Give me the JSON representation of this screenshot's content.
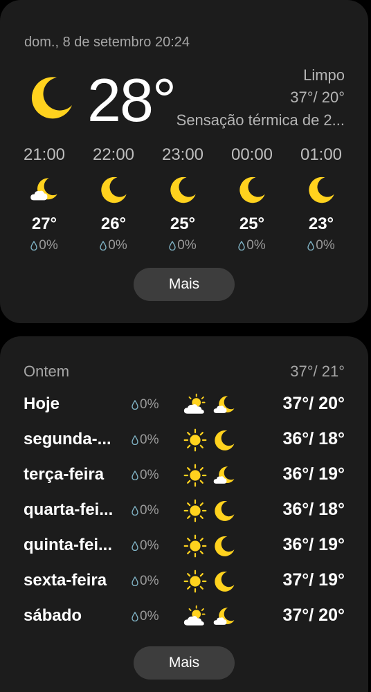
{
  "colors": {
    "card": "#1c1c1c",
    "button": "#3d3d3d",
    "icon_yellow": "#ffd21e",
    "muted_text": "#a6a6a6"
  },
  "current": {
    "date": "dom., 8 de setembro 20:24",
    "temp": "28°",
    "icon": "moon-icon",
    "condition": "Limpo",
    "range": "37°/ 20°",
    "feels_like": "Sensação térmica de 2..."
  },
  "hourly": [
    {
      "time": "21:00",
      "icon": "partly-cloudy-night-icon",
      "temp": "27°",
      "rain": "0%"
    },
    {
      "time": "22:00",
      "icon": "moon-icon",
      "temp": "26°",
      "rain": "0%"
    },
    {
      "time": "23:00",
      "icon": "moon-icon",
      "temp": "25°",
      "rain": "0%"
    },
    {
      "time": "00:00",
      "icon": "moon-icon",
      "temp": "25°",
      "rain": "0%"
    },
    {
      "time": "01:00",
      "icon": "moon-icon",
      "temp": "23°",
      "rain": "0%"
    }
  ],
  "more_label": "Mais",
  "yesterday": {
    "label": "Ontem",
    "range": "37°/ 21°"
  },
  "daily": [
    {
      "day": "Hoje",
      "rain": "0%",
      "day_icon": "partly-cloudy-day-icon",
      "night_icon": "partly-cloudy-night-icon",
      "range": "37°/ 20°"
    },
    {
      "day": "segunda-...",
      "rain": "0%",
      "day_icon": "sun-icon",
      "night_icon": "moon-icon",
      "range": "36°/ 18°"
    },
    {
      "day": "terça-feira",
      "rain": "0%",
      "day_icon": "sun-icon",
      "night_icon": "partly-cloudy-night-icon",
      "range": "36°/ 19°"
    },
    {
      "day": "quarta-fei...",
      "rain": "0%",
      "day_icon": "sun-icon",
      "night_icon": "moon-icon",
      "range": "36°/ 18°"
    },
    {
      "day": "quinta-fei...",
      "rain": "0%",
      "day_icon": "sun-icon",
      "night_icon": "moon-icon",
      "range": "36°/ 19°"
    },
    {
      "day": "sexta-feira",
      "rain": "0%",
      "day_icon": "sun-icon",
      "night_icon": "moon-icon",
      "range": "37°/ 19°"
    },
    {
      "day": "sábado",
      "rain": "0%",
      "day_icon": "partly-cloudy-day-icon",
      "night_icon": "partly-cloudy-night-icon",
      "range": "37°/ 20°"
    }
  ]
}
